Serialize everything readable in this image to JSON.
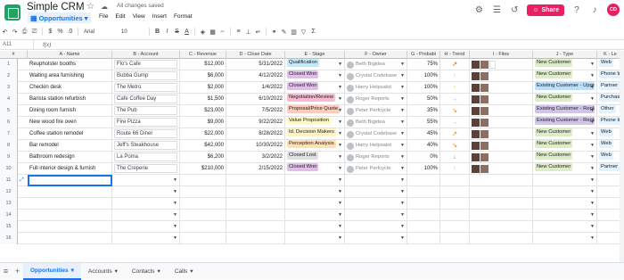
{
  "app": {
    "title": "Simple CRM",
    "saved_status": "All changes saved",
    "sheet_name": "Opportunities",
    "menu": [
      "File",
      "Edit",
      "View",
      "Insert",
      "Format"
    ],
    "share_label": "Share",
    "avatar_initials": "CD"
  },
  "toolbar": {
    "font": "Arial",
    "size": "10"
  },
  "formula": {
    "cell_ref": "A11",
    "fx": "f(x)"
  },
  "columns": [
    {
      "label": "A - Name"
    },
    {
      "label": "B - Account"
    },
    {
      "label": "C - Revenue"
    },
    {
      "label": "D - Close Date"
    },
    {
      "label": "E - Stage"
    },
    {
      "label": "F - Owner"
    },
    {
      "label": "G - Probabi"
    },
    {
      "label": "H - Trend"
    },
    {
      "label": "I - Files"
    },
    {
      "label": "J - Type"
    },
    {
      "label": "K - Le"
    }
  ],
  "stage_colors": {
    "Qualification": "#c6e9f7",
    "Closed Won": "#e1bee7",
    "Negotiation/Review": "#f8bbd0",
    "Proposal/Price Quote": "#ffccbc",
    "Value Proposition": "#fff9c4",
    "Id. Decision Makers": "#fff3c4",
    "Perception Analysis": "#ffe0b2",
    "Closed Lost": "#e0e0e0"
  },
  "type_colors": {
    "New Customer": "#dcedc8",
    "Existing Customer - Upgrade": "#bbdefb",
    "Existing Customer - Replacement": "#d1c4e9"
  },
  "rows": [
    {
      "n": "1",
      "name": "Reupholster booths",
      "account": "Flo's Cafe",
      "revenue": "$12,000",
      "date": "5/31/2022",
      "stage": "Qualification",
      "owner": "Beth Bigidea",
      "prob": "75%",
      "trend": "↗",
      "trend_color": "#f57c00",
      "type": "New Customer",
      "lead": "Web"
    },
    {
      "n": "2",
      "name": "Waiting area furnishing",
      "account": "Bubba Gump",
      "revenue": "$6,000",
      "date": "4/12/2022",
      "stage": "Closed Won",
      "owner": "Crystal Codebase",
      "prob": "100%",
      "trend": "↑",
      "trend_color": "#f9a825",
      "type": "New Customer",
      "lead": "Phone In"
    },
    {
      "n": "3",
      "name": "Checkin desk",
      "account": "The Metro",
      "revenue": "$2,000",
      "date": "1/4/2022",
      "stage": "Closed Won",
      "owner": "Harry Helpsalot",
      "prob": "100%",
      "trend": "↑",
      "trend_color": "#f9a825",
      "type": "Existing Customer - Upgrade",
      "lead": "Partner R"
    },
    {
      "n": "4",
      "name": "Barista station refurbish",
      "account": "Cafe Coffee Day",
      "revenue": "$1,500",
      "date": "6/10/2022",
      "stage": "Negotiation/Review",
      "owner": "Roger Reports",
      "prob": "50%",
      "trend": "→",
      "trend_color": "#f9a825",
      "type": "New Customer",
      "lead": "Purchase"
    },
    {
      "n": "5",
      "name": "Dining room furnish",
      "account": "The Pub",
      "revenue": "$23,000",
      "date": "7/5/2022",
      "stage": "Proposal/Price Quote",
      "owner": "Peter Perfcycle",
      "prob": "35%",
      "trend": "↘",
      "trend_color": "#f9a825",
      "type": "Existing Customer - Replacement",
      "lead": "Other"
    },
    {
      "n": "6",
      "name": "New wood fire oven",
      "account": "Fire Pizza",
      "revenue": "$9,000",
      "date": "9/22/2022",
      "stage": "Value Proposition",
      "owner": "Beth Bigidea",
      "prob": "55%",
      "trend": "→",
      "trend_color": "#f9a825",
      "type": "Existing Customer - Replacement",
      "lead": "Phone In"
    },
    {
      "n": "7",
      "name": "Coffee station remodel",
      "account": "Route 66 Diner",
      "revenue": "$22,000",
      "date": "8/28/2022",
      "stage": "Id. Decision Makers",
      "owner": "Crystal Codebase",
      "prob": "45%",
      "trend": "↗",
      "trend_color": "#f9a825",
      "type": "New Customer",
      "lead": "Web"
    },
    {
      "n": "8",
      "name": "Bar remodel",
      "account": "Jeff's Steakhouse",
      "revenue": "$42,000",
      "date": "10/30/2022",
      "stage": "Perception Analysis",
      "owner": "Harry Helpsalot",
      "prob": "40%",
      "trend": "↘",
      "trend_color": "#f9a825",
      "type": "New Customer",
      "lead": "Web"
    },
    {
      "n": "9",
      "name": "Bathroom redesign",
      "account": "La Poma",
      "revenue": "$6,200",
      "date": "3/2/2022",
      "stage": "Closed Lost",
      "owner": "Roger Reports",
      "prob": "0%",
      "trend": "↓",
      "trend_color": "#e53935",
      "type": "New Customer",
      "lead": "Web"
    },
    {
      "n": "10",
      "name": "Full interior design & furnish",
      "account": "The Creperie",
      "revenue": "$210,000",
      "date": "2/15/2022",
      "stage": "Closed Won",
      "owner": "Peter Perfcycle",
      "prob": "100%",
      "trend": "↑",
      "trend_color": "#f9a825",
      "type": "New Customer",
      "lead": "Partner R"
    }
  ],
  "empty_rows": [
    "11",
    "12",
    "13",
    "14",
    "15",
    "16"
  ],
  "tabs": [
    {
      "label": "Opportunities",
      "active": true
    },
    {
      "label": "Accounts",
      "active": false
    },
    {
      "label": "Contacts",
      "active": false
    },
    {
      "label": "Calls",
      "active": false
    }
  ]
}
